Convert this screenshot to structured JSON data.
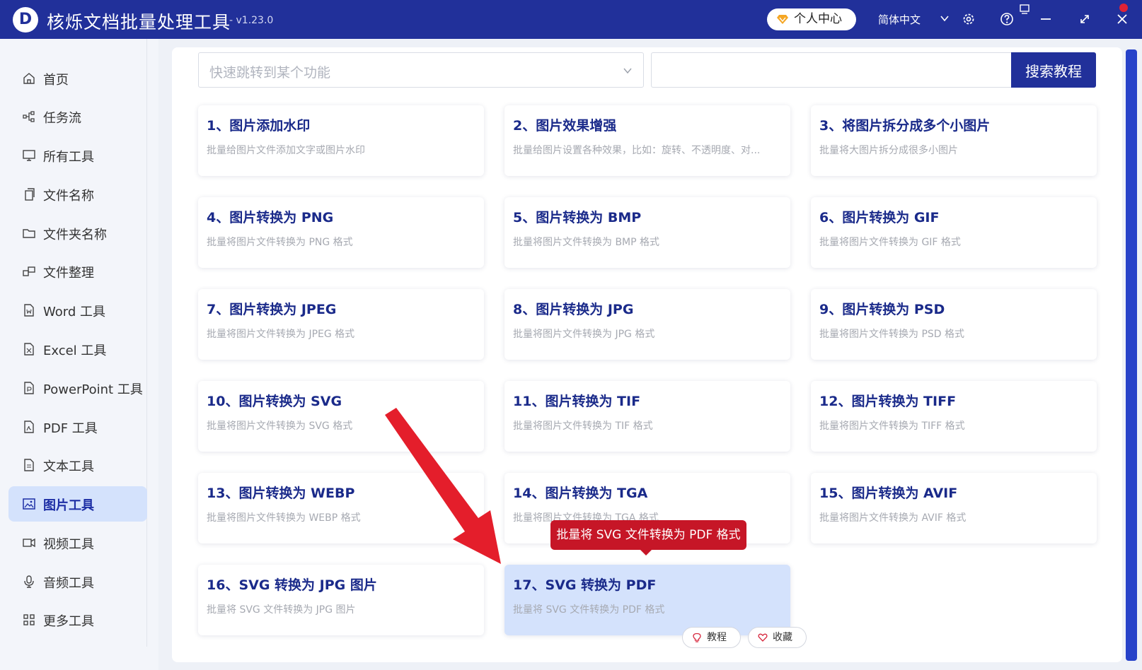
{
  "app": {
    "logo_letter": "D",
    "title": "核烁文档批量处理工具",
    "version": "- v1.23.0"
  },
  "header": {
    "user_center": "个人中心",
    "language": "简体中文"
  },
  "sidebar": {
    "items": [
      {
        "label": "首页",
        "icon": "home-icon"
      },
      {
        "label": "任务流",
        "icon": "workflow-icon"
      },
      {
        "label": "所有工具",
        "icon": "monitor-icon"
      },
      {
        "label": "文件名称",
        "icon": "file-copy-icon"
      },
      {
        "label": "文件夹名称",
        "icon": "folder-icon"
      },
      {
        "label": "文件整理",
        "icon": "organize-icon"
      },
      {
        "label": "Word 工具",
        "icon": "word-file-icon"
      },
      {
        "label": "Excel 工具",
        "icon": "excel-file-icon"
      },
      {
        "label": "PowerPoint 工具",
        "icon": "ppt-file-icon"
      },
      {
        "label": "PDF 工具",
        "icon": "pdf-file-icon"
      },
      {
        "label": "文本工具",
        "icon": "text-file-icon"
      },
      {
        "label": "图片工具",
        "icon": "image-icon",
        "active": true
      },
      {
        "label": "视频工具",
        "icon": "video-icon"
      },
      {
        "label": "音频工具",
        "icon": "microphone-icon"
      },
      {
        "label": "更多工具",
        "icon": "grid-icon"
      }
    ]
  },
  "search": {
    "jump_placeholder": "快速跳转到某个功能",
    "search_button": "搜索教程"
  },
  "cards": [
    {
      "title": "1、图片添加水印",
      "desc": "批量给图片文件添加文字或图片水印"
    },
    {
      "title": "2、图片效果增强",
      "desc": "批量给图片设置各种效果，比如：旋转、不透明度、对..."
    },
    {
      "title": "3、将图片拆分成多个小图片",
      "desc": "批量将大图片拆分成很多小图片"
    },
    {
      "title": "4、图片转换为 PNG",
      "desc": "批量将图片文件转换为 PNG 格式"
    },
    {
      "title": "5、图片转换为 BMP",
      "desc": "批量将图片文件转换为 BMP 格式"
    },
    {
      "title": "6、图片转换为 GIF",
      "desc": "批量将图片文件转换为 GIF 格式"
    },
    {
      "title": "7、图片转换为 JPEG",
      "desc": "批量将图片文件转换为 JPEG 格式"
    },
    {
      "title": "8、图片转换为 JPG",
      "desc": "批量将图片文件转换为 JPG 格式"
    },
    {
      "title": "9、图片转换为 PSD",
      "desc": "批量将图片文件转换为 PSD 格式"
    },
    {
      "title": "10、图片转换为 SVG",
      "desc": "批量将图片文件转换为 SVG 格式"
    },
    {
      "title": "11、图片转换为 TIF",
      "desc": "批量将图片文件转换为 TIF 格式"
    },
    {
      "title": "12、图片转换为 TIFF",
      "desc": "批量将图片文件转换为 TIFF 格式"
    },
    {
      "title": "13、图片转换为 WEBP",
      "desc": "批量将图片文件转换为 WEBP 格式"
    },
    {
      "title": "14、图片转换为 TGA",
      "desc": "批量将图片文件转换为 TGA 格式"
    },
    {
      "title": "15、图片转换为 AVIF",
      "desc": "批量将图片文件转换为 AVIF 格式"
    },
    {
      "title": "16、SVG 转换为 JPG 图片",
      "desc": "批量将 SVG 文件转换为 JPG 图片"
    },
    {
      "title": "17、SVG 转换为 PDF",
      "desc": "批量将 SVG 文件转换为 PDF 格式",
      "highlighted": true
    }
  ],
  "tooltip": "批量将 SVG 文件转换为 PDF 格式",
  "card_actions": {
    "tutorial": "教程",
    "favorite": "收藏"
  },
  "colors": {
    "titlebar": "#21309a",
    "accent_text": "#1a2a8a",
    "active_nav_bg": "#d4e2fc",
    "tooltip": "#c61627",
    "arrow": "#e41e2b"
  }
}
